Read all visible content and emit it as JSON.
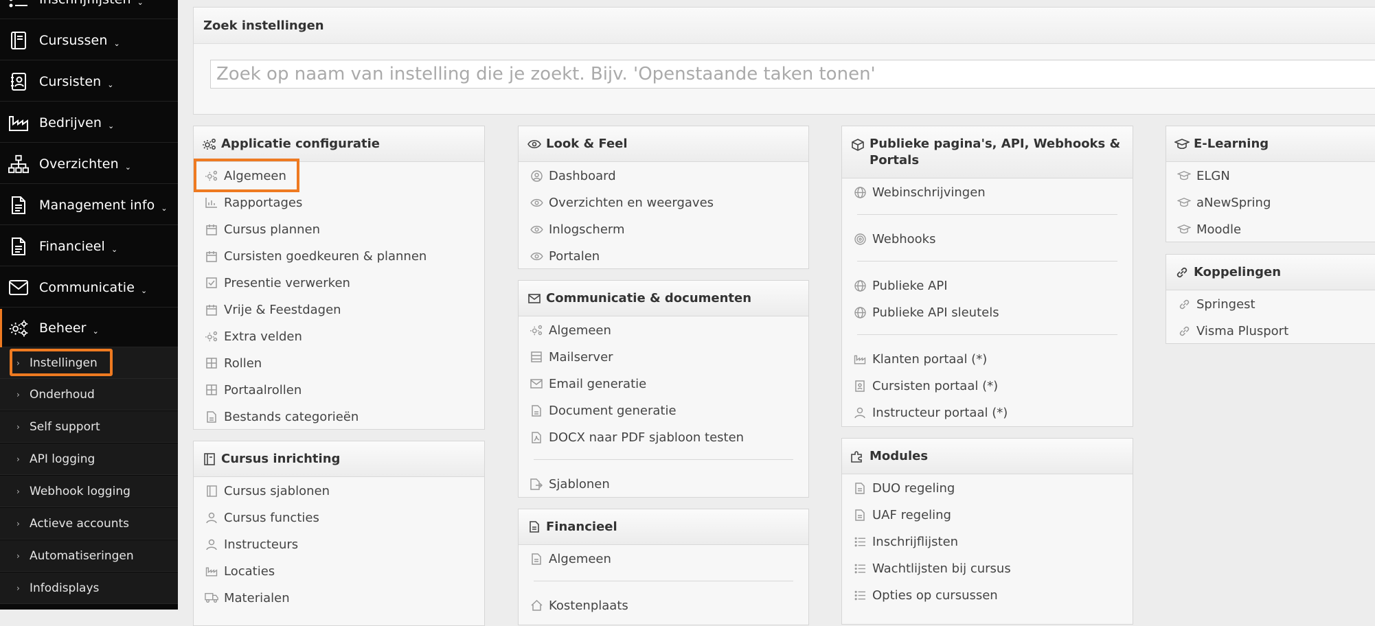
{
  "sidebar": {
    "items": [
      {
        "label": "Inschrijflijsten",
        "icon": "list-icon"
      },
      {
        "label": "Cursussen",
        "icon": "book-icon"
      },
      {
        "label": "Cursisten",
        "icon": "contact-card-icon"
      },
      {
        "label": "Bedrijven",
        "icon": "factory-icon"
      },
      {
        "label": "Overzichten",
        "icon": "sitemap-icon"
      },
      {
        "label": "Management info",
        "icon": "document-icon"
      },
      {
        "label": "Financieel",
        "icon": "document-icon"
      },
      {
        "label": "Communicatie",
        "icon": "envelope-icon"
      },
      {
        "label": "Beheer",
        "icon": "gears-icon"
      }
    ],
    "chevron": "⌄",
    "subitems": [
      {
        "label": "Instellingen"
      },
      {
        "label": "Onderhoud"
      },
      {
        "label": "Self support"
      },
      {
        "label": "API logging"
      },
      {
        "label": "Webhook logging"
      },
      {
        "label": "Actieve accounts"
      },
      {
        "label": "Automatiseringen"
      },
      {
        "label": "Infodisplays"
      }
    ],
    "sub_arrow": "›"
  },
  "search": {
    "title": "Zoek instellingen",
    "placeholder": "Zoek op naam van instelling die je zoekt. Bijv. 'Openstaande taken tonen'"
  },
  "panels": {
    "applicatie": {
      "title": "Applicatie configuratie",
      "items": [
        "Algemeen",
        "Rapportages",
        "Cursus plannen",
        "Cursisten goedkeuren & plannen",
        "Presentie verwerken",
        "Vrije & Feestdagen",
        "Extra velden",
        "Rollen",
        "Portaalrollen",
        "Bestands categorieën"
      ]
    },
    "cursus_inrichting": {
      "title": "Cursus inrichting",
      "items": [
        "Cursus sjablonen",
        "Cursus functies",
        "Instructeurs",
        "Locaties",
        "Materialen"
      ]
    },
    "look_feel": {
      "title": "Look & Feel",
      "items": [
        "Dashboard",
        "Overzichten en weergaves",
        "Inlogscherm",
        "Portalen"
      ]
    },
    "communicatie": {
      "title": "Communicatie & documenten",
      "items": [
        "Algemeen",
        "Mailserver",
        "Email generatie",
        "Document generatie",
        "DOCX naar PDF sjabloon testen",
        "Sjablonen"
      ]
    },
    "financieel": {
      "title": "Financieel",
      "items": [
        "Algemeen",
        "Kostenplaats"
      ]
    },
    "publieke": {
      "title": "Publieke pagina's, API, Webhooks & Portals",
      "items": [
        "Webinschrijvingen",
        "Webhooks",
        "Publieke API",
        "Publieke API sleutels",
        "Klanten portaal (*)",
        "Cursisten portaal (*)",
        "Instructeur portaal (*)"
      ]
    },
    "modules": {
      "title": "Modules",
      "items": [
        "DUO regeling",
        "UAF regeling",
        "Inschrijflijsten",
        "Wachtlijsten bij cursus",
        "Opties op cursussen"
      ]
    },
    "elearning": {
      "title": "E-Learning",
      "items": [
        "ELGN",
        "aNewSpring",
        "Moodle"
      ]
    },
    "koppelingen": {
      "title": "Koppelingen",
      "items": [
        "Springest",
        "Visma Plusport"
      ]
    }
  },
  "colors": {
    "sidebar_bg": "#0a0a0a",
    "highlight": "#ee7a21",
    "page_bg": "#ededed"
  }
}
